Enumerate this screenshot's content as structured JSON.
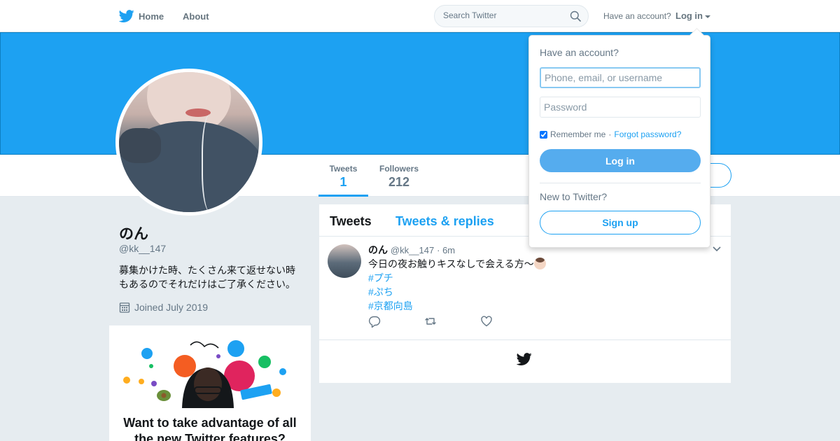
{
  "nav": {
    "home_label": "Home",
    "about_label": "About",
    "search_placeholder": "Search Twitter",
    "have_account": "Have an account?",
    "login_label": "Log in"
  },
  "profile": {
    "name": "のん",
    "handle": "@kk__147",
    "bio": "募集かけた時、たくさん来て返せない時もあるのでそれだけはご了承ください。",
    "joined": "Joined July 2019",
    "stats": [
      {
        "label": "Tweets",
        "value": "1"
      },
      {
        "label": "Followers",
        "value": "212"
      }
    ]
  },
  "promo": {
    "title": "Want to take advantage of all the new Twitter features?"
  },
  "timeline": {
    "tabs": [
      "Tweets",
      "Tweets & replies"
    ],
    "tweet": {
      "name": "のん",
      "handle": "@kk__147",
      "time": "· 6m",
      "text": "今日の夜お触りキスなしで会える方〜",
      "hashtags": [
        "#プチ",
        "#ぷち",
        "#京都向島"
      ]
    }
  },
  "login_dropdown": {
    "title": "Have an account?",
    "username_placeholder": "Phone, email, or username",
    "password_placeholder": "Password",
    "remember_label": "Remember me",
    "separator": "·",
    "forgot_label": "Forgot password?",
    "login_button": "Log in",
    "new_label": "New to Twitter?",
    "signup_button": "Sign up"
  },
  "colors": {
    "brand": "#1da1f2",
    "header_banner": "#1da1f2",
    "page_background": "#e6ecf0"
  },
  "icons": [
    "twitter-bird-icon",
    "search-icon",
    "calendar-icon",
    "reply-icon",
    "retweet-icon",
    "like-icon",
    "chevron-down-icon"
  ]
}
